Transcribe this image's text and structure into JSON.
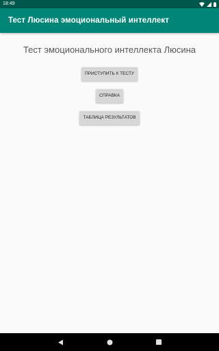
{
  "status_bar": {
    "time": "18:49"
  },
  "app_bar": {
    "title": "Тест Люсина эмоциональный интеллект"
  },
  "main": {
    "heading": "Тест эмоционального интеллекта Люсина",
    "buttons": {
      "start": "ПРИСТУПИТЬ К ТЕСТУ",
      "help": "СПРАВКА",
      "results": "ТАБЛИЦА РЕЗУЛЬТАТОВ"
    }
  },
  "colors": {
    "status_bar": "#00574b",
    "app_bar": "#008577",
    "background": "#fafafa",
    "button": "#d6d7d7"
  },
  "icons": {
    "status": [
      "wifi-icon",
      "signal-icon",
      "battery-icon"
    ],
    "nav": [
      "back-icon",
      "home-icon",
      "recents-icon"
    ]
  }
}
